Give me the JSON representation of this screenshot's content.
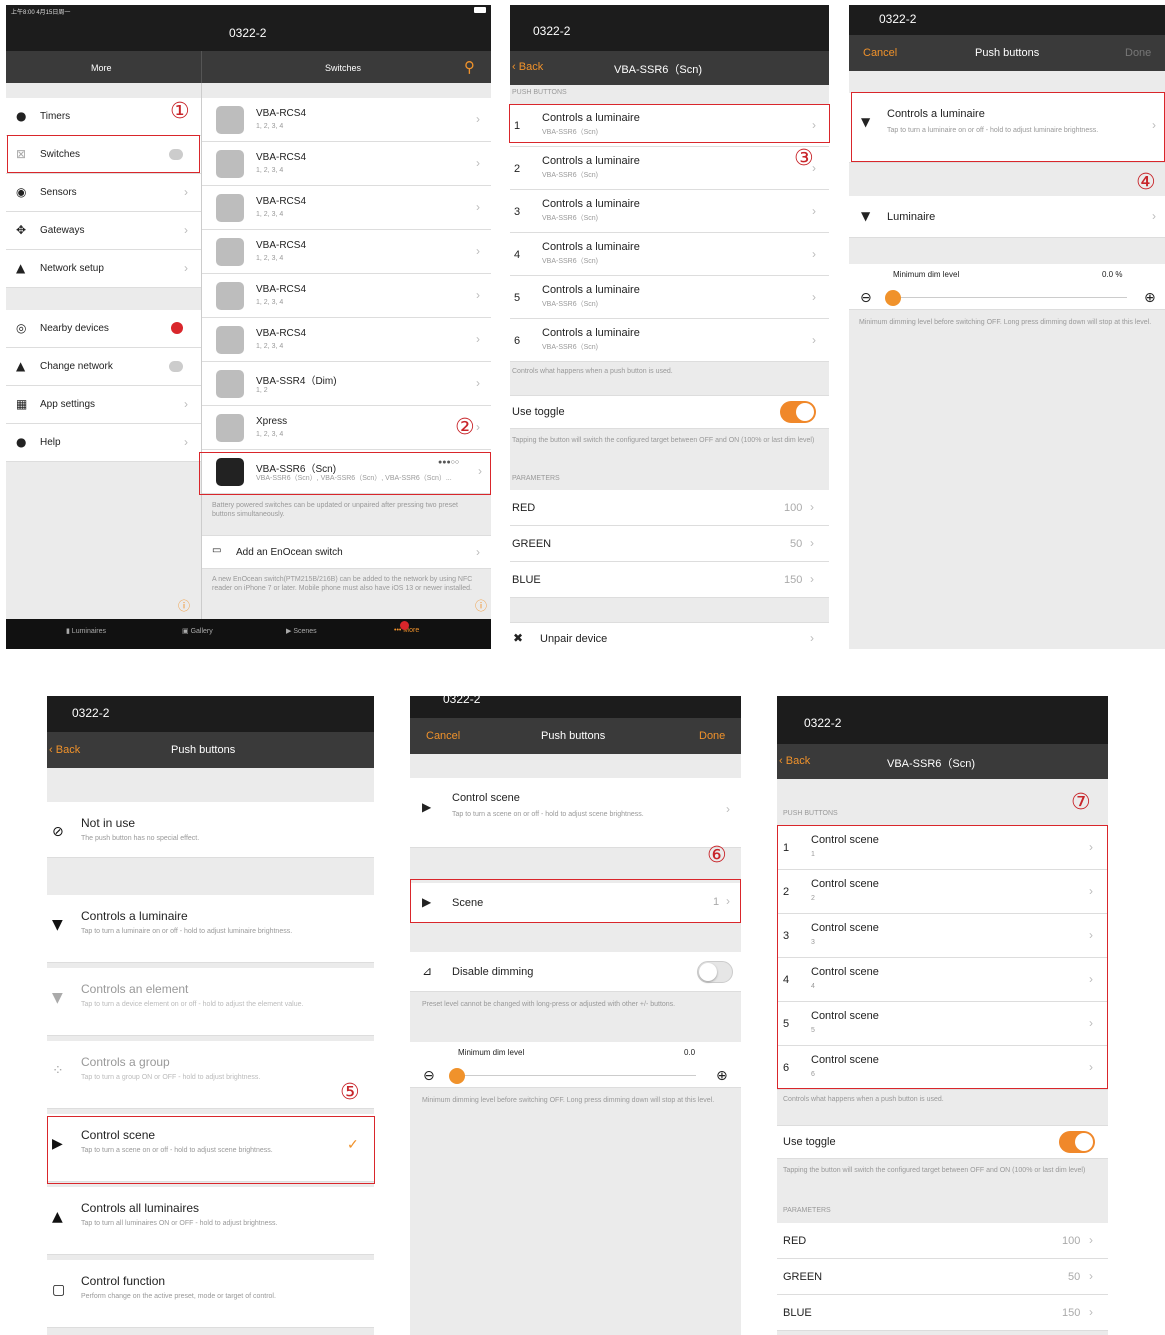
{
  "p1": {
    "status": "上午8:00  4月15日周一",
    "title": "0322-2",
    "left_header": "More",
    "right_header": "Switches",
    "menu": [
      "Timers",
      "Switches",
      "Sensors",
      "Gateways",
      "Network setup",
      "Nearby devices",
      "Change network",
      "App settings",
      "Help"
    ],
    "switches": [
      {
        "name": "VBA-RCS4",
        "sub": "1, 2, 3, 4"
      },
      {
        "name": "VBA-RCS4",
        "sub": "1, 2, 3, 4"
      },
      {
        "name": "VBA-RCS4",
        "sub": "1, 2, 3, 4"
      },
      {
        "name": "VBA-RCS4",
        "sub": "1, 2, 3, 4"
      },
      {
        "name": "VBA-RCS4",
        "sub": "1, 2, 3, 4"
      },
      {
        "name": "VBA-RCS4",
        "sub": "1, 2, 3, 4"
      },
      {
        "name": "VBA-SSR4（Dim)",
        "sub": "1, 2"
      },
      {
        "name": "Xpress",
        "sub": "1, 2, 3, 4"
      },
      {
        "name": "VBA-SSR6（Scn)",
        "sub": "VBA-SSR6（Scn）, VBA-SSR6（Scn）, VBA-SSR6（Scn）..."
      }
    ],
    "battery_note": "Battery powered switches can be updated or unpaired after pressing two preset buttons simultaneously.",
    "add_switch": "Add an EnOcean switch",
    "add_note": "A new EnOcean switch(PTM215B/216B) can be added to the network by using NFC reader on iPhone 7 or later. Mobile phone must also have iOS 13 or newer installed.",
    "tabs": [
      "Luminaires",
      "Gallery",
      "Scenes",
      "More"
    ],
    "markers": [
      "①",
      "②"
    ]
  },
  "p2": {
    "title": "0322-2",
    "back": "Back",
    "nav_title": "VBA-SSR6（Scn)",
    "section": "PUSH BUTTONS",
    "buttons": [
      {
        "num": "1",
        "label": "Controls a luminaire",
        "sub": "VBA-SSR6（Scn)"
      },
      {
        "num": "2",
        "label": "Controls a luminaire",
        "sub": "VBA-SSR6（Scn)"
      },
      {
        "num": "3",
        "label": "Controls a luminaire",
        "sub": "VBA-SSR6（Scn)"
      },
      {
        "num": "4",
        "label": "Controls a luminaire",
        "sub": "VBA-SSR6（Scn)"
      },
      {
        "num": "5",
        "label": "Controls a luminaire",
        "sub": "VBA-SSR6（Scn)"
      },
      {
        "num": "6",
        "label": "Controls a luminaire",
        "sub": "VBA-SSR6（Scn)"
      }
    ],
    "buttons_note": "Controls what happens when a push button is used.",
    "use_toggle": "Use toggle",
    "toggle_note": "Tapping the button will switch the configured target between OFF and ON (100% or last dim level)",
    "params_header": "PARAMETERS",
    "params": [
      {
        "name": "RED",
        "value": "100"
      },
      {
        "name": "GREEN",
        "value": "50"
      },
      {
        "name": "BLUE",
        "value": "150"
      }
    ],
    "unpair": "Unpair device",
    "marker": "③"
  },
  "p3": {
    "title": "0322-2",
    "cancel": "Cancel",
    "nav_title": "Push buttons",
    "done": "Done",
    "option_title": "Controls a luminaire",
    "option_desc": "Tap to turn a luminaire on or off - hold to adjust luminaire brightness.",
    "luminaire": "Luminaire",
    "min_dim": "Minimum dim level",
    "min_val": "0.0 %",
    "dim_note": "Minimum dimming level before switching OFF. Long press dimming down will stop at this level.",
    "marker": "④"
  },
  "p4": {
    "title": "0322-2",
    "back": "Back",
    "nav_title": "Push buttons",
    "options": [
      {
        "label": "Not in use",
        "desc": "The push button has no special effect."
      },
      {
        "label": "Controls a luminaire",
        "desc": "Tap to turn a luminaire on or off - hold to adjust luminaire brightness."
      },
      {
        "label": "Controls an element",
        "desc": "Tap to turn a device element on or off - hold to adjust the element value."
      },
      {
        "label": "Controls a group",
        "desc": "Tap to turn a group ON or OFF - hold to adjust brightness."
      },
      {
        "label": "Control scene",
        "desc": "Tap to turn a scene on or off - hold to adjust scene brightness."
      },
      {
        "label": "Controls all luminaires",
        "desc": "Tap to turn all luminaires ON or OFF - hold to adjust brightness."
      },
      {
        "label": "Control function",
        "desc": "Perform change on the active preset, mode or target of control."
      }
    ],
    "marker": "⑤"
  },
  "p5": {
    "title": "0322-2",
    "cancel": "Cancel",
    "nav_title": "Push buttons",
    "done": "Done",
    "option_title": "Control scene",
    "option_desc": "Tap to turn a scene on or off - hold to adjust scene brightness.",
    "scene": "Scene",
    "scene_val": "1",
    "disable": "Disable dimming",
    "disable_note": "Preset level cannot be changed with long-press or adjusted with other +/- buttons.",
    "min_dim": "Minimum dim level",
    "min_val": "0.0",
    "dim_note": "Minimum dimming level before switching OFF. Long press dimming down will stop at this level.",
    "marker": "⑥"
  },
  "p6": {
    "title": "0322-2",
    "back": "Back",
    "nav_title": "VBA-SSR6（Scn)",
    "section": "PUSH BUTTONS",
    "buttons": [
      {
        "num": "1",
        "label": "Control scene",
        "sub": "1"
      },
      {
        "num": "2",
        "label": "Control scene",
        "sub": "2"
      },
      {
        "num": "3",
        "label": "Control scene",
        "sub": "3"
      },
      {
        "num": "4",
        "label": "Control scene",
        "sub": "4"
      },
      {
        "num": "5",
        "label": "Control scene",
        "sub": "5"
      },
      {
        "num": "6",
        "label": "Control scene",
        "sub": "6"
      }
    ],
    "buttons_note": "Controls what happens when a push button is used.",
    "use_toggle": "Use toggle",
    "toggle_note": "Tapping the button will switch the configured target between OFF and ON (100% or last dim level)",
    "params_header": "PARAMETERS",
    "params": [
      {
        "name": "RED",
        "value": "100"
      },
      {
        "name": "GREEN",
        "value": "50"
      },
      {
        "name": "BLUE",
        "value": "150"
      }
    ],
    "marker": "⑦"
  }
}
